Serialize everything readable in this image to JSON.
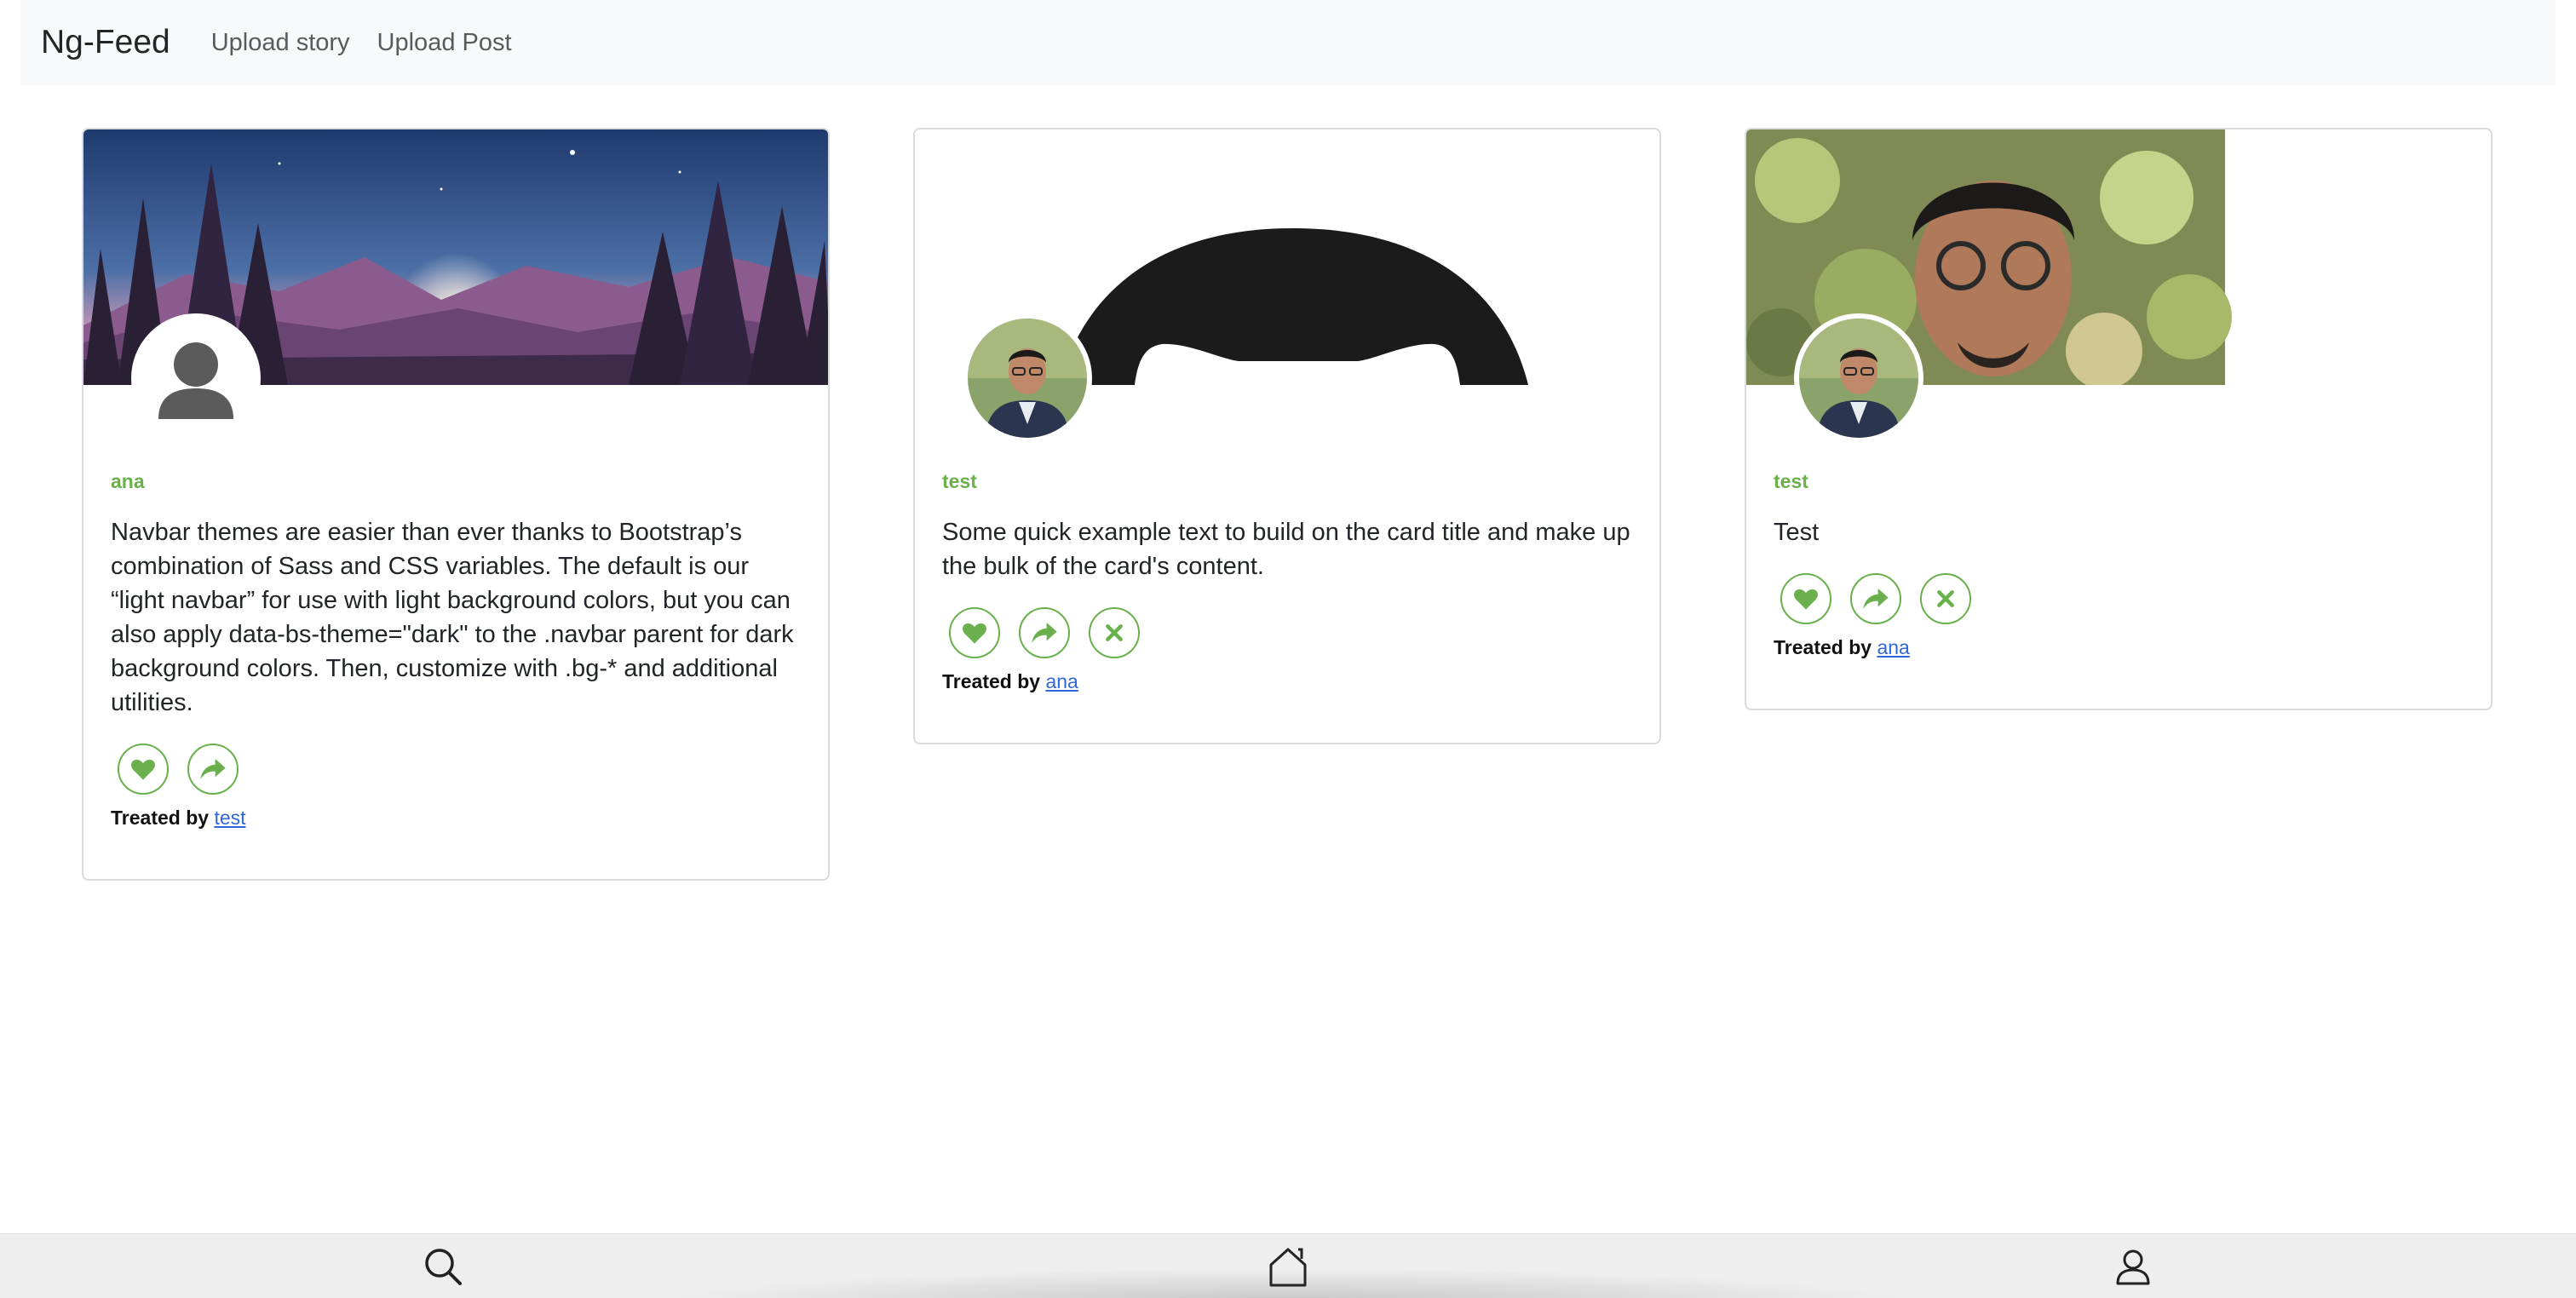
{
  "navbar": {
    "brand": "Ng-Feed",
    "links": [
      "Upload story",
      "Upload Post"
    ]
  },
  "cards": [
    {
      "author": "ana",
      "text": "Navbar themes are easier than ever thanks to Bootstrap’s combination of Sass and CSS variables. The default is our “light navbar” for use with light background colors, but you can also apply data-bs-theme=\"dark\" to the .navbar parent for dark background colors. Then, customize with .bg-* and additional utilities.",
      "treated_prefix": "Treated by",
      "treated_user": "test"
    },
    {
      "author": "test",
      "text": "Some quick example text to build on the card title and make up the bulk of the card's content.",
      "treated_prefix": "Treated by",
      "treated_user": "ana"
    },
    {
      "author": "test",
      "text": "Test",
      "treated_prefix": "Treated by",
      "treated_user": "ana"
    }
  ],
  "bottom_nav": [
    "search-icon",
    "home-icon",
    "user-icon"
  ],
  "colors": {
    "accent_green": "#6ab04c",
    "link_blue": "#2f66d8",
    "navbar_bg": "#f8f9fa"
  }
}
